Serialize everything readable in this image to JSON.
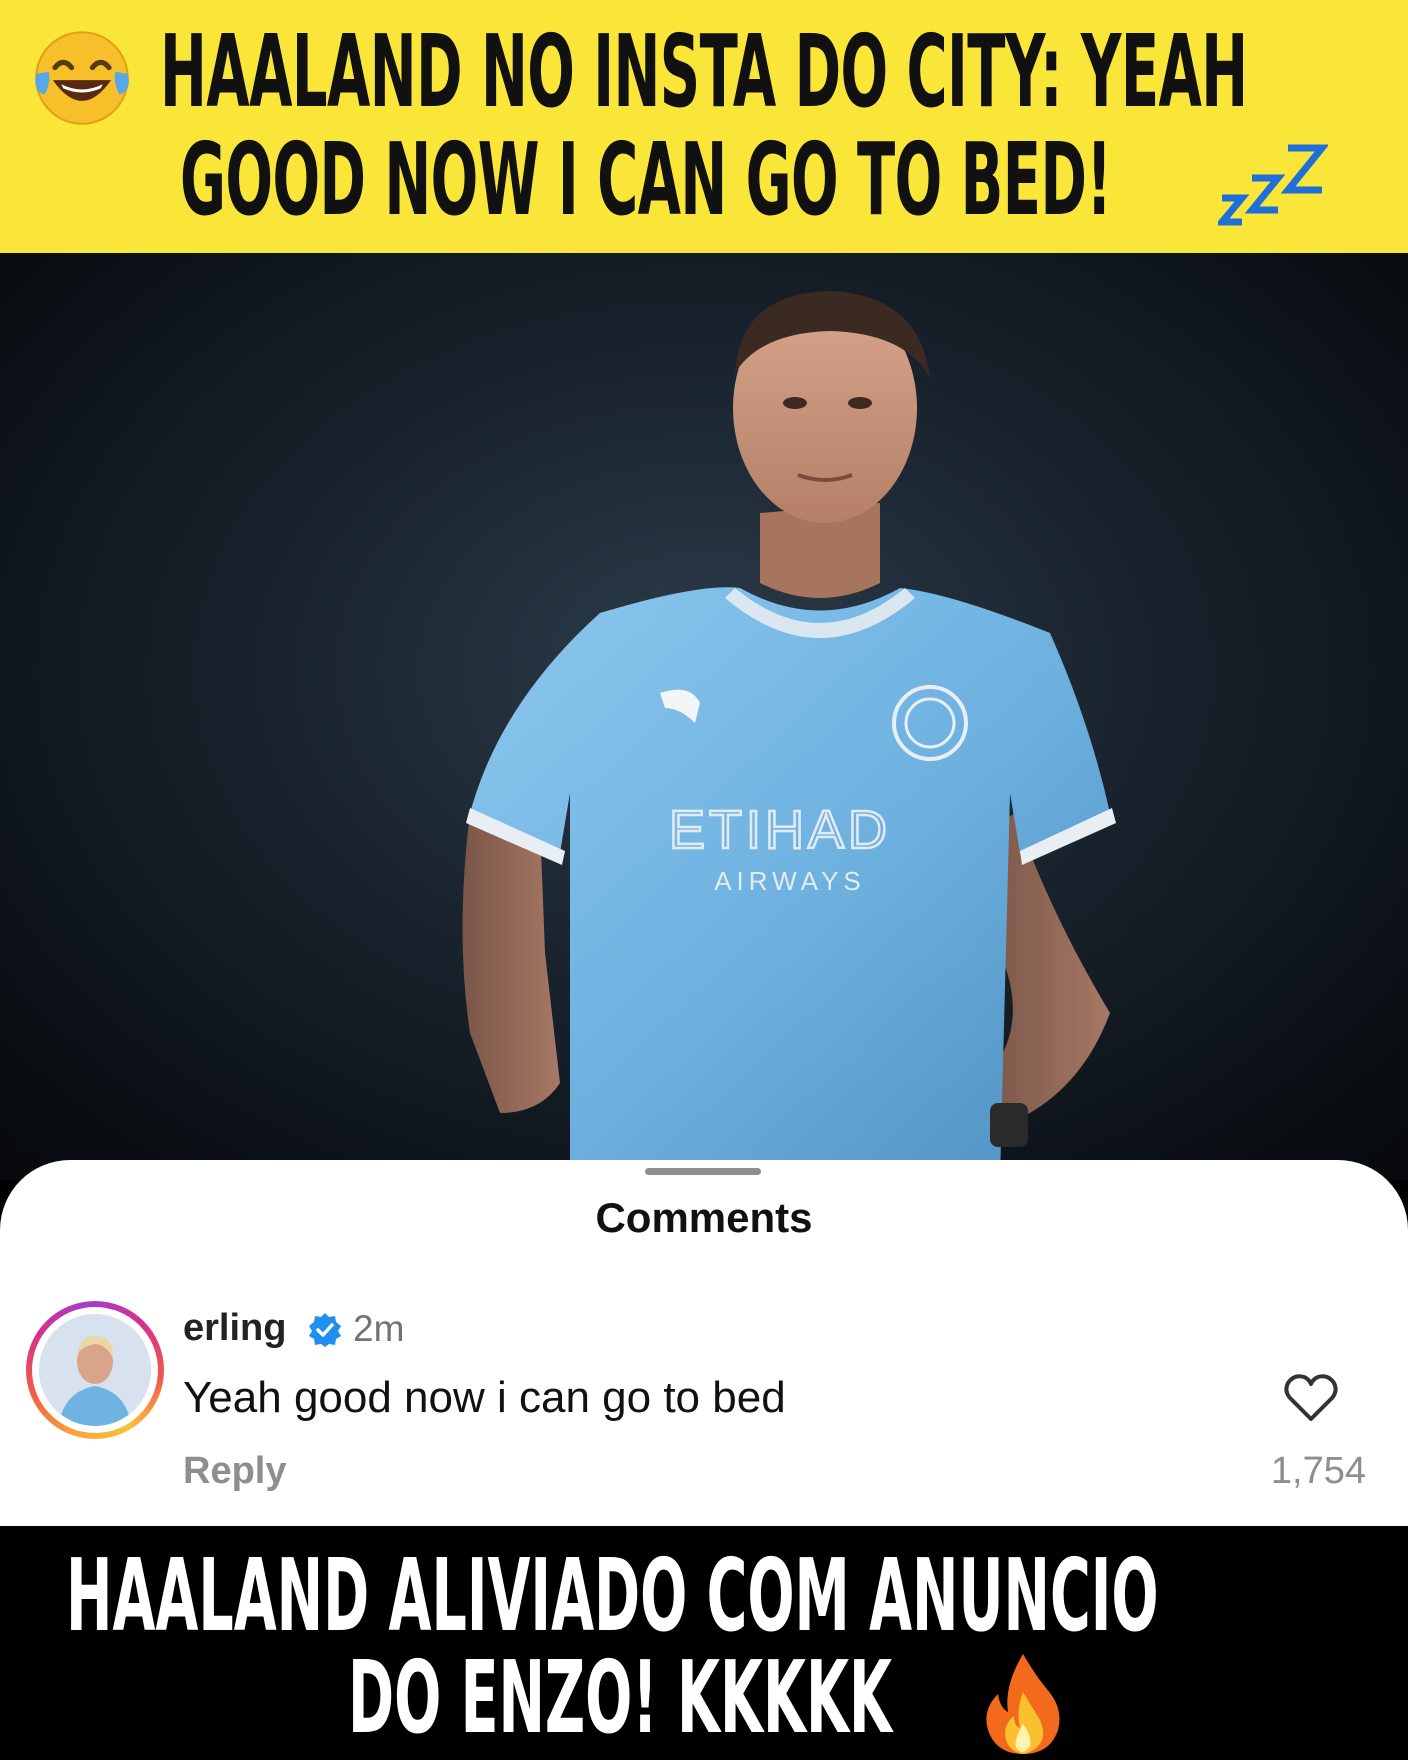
{
  "top_banner": {
    "line1": "HAALAND NO INSTA DO CITY: YEAH",
    "line2": "GOOD NOW I CAN GO TO BED!",
    "leading_emoji": "laughing-tears-emoji",
    "trailing_emoji": "zzz-sleep-emoji",
    "background": "#f9e638"
  },
  "photo": {
    "subject": "player-in-sky-blue-kit",
    "shirt_sponsor_line1": "ETIHAD",
    "shirt_sponsor_line2": "AIRWAYS",
    "shirt_color": "#6fb3e0"
  },
  "comments_sheet": {
    "title": "Comments",
    "comment": {
      "username": "erling",
      "verified": true,
      "time": "2m",
      "text": "Yeah good now i can go to bed",
      "reply_label": "Reply",
      "likes": "1,754"
    }
  },
  "bottom_banner": {
    "line1": "HAALAND ALIVIADO COM ANUNCIO",
    "line2": "DO ENZO! KKKKK",
    "trailing_emoji": "fire-emoji"
  }
}
